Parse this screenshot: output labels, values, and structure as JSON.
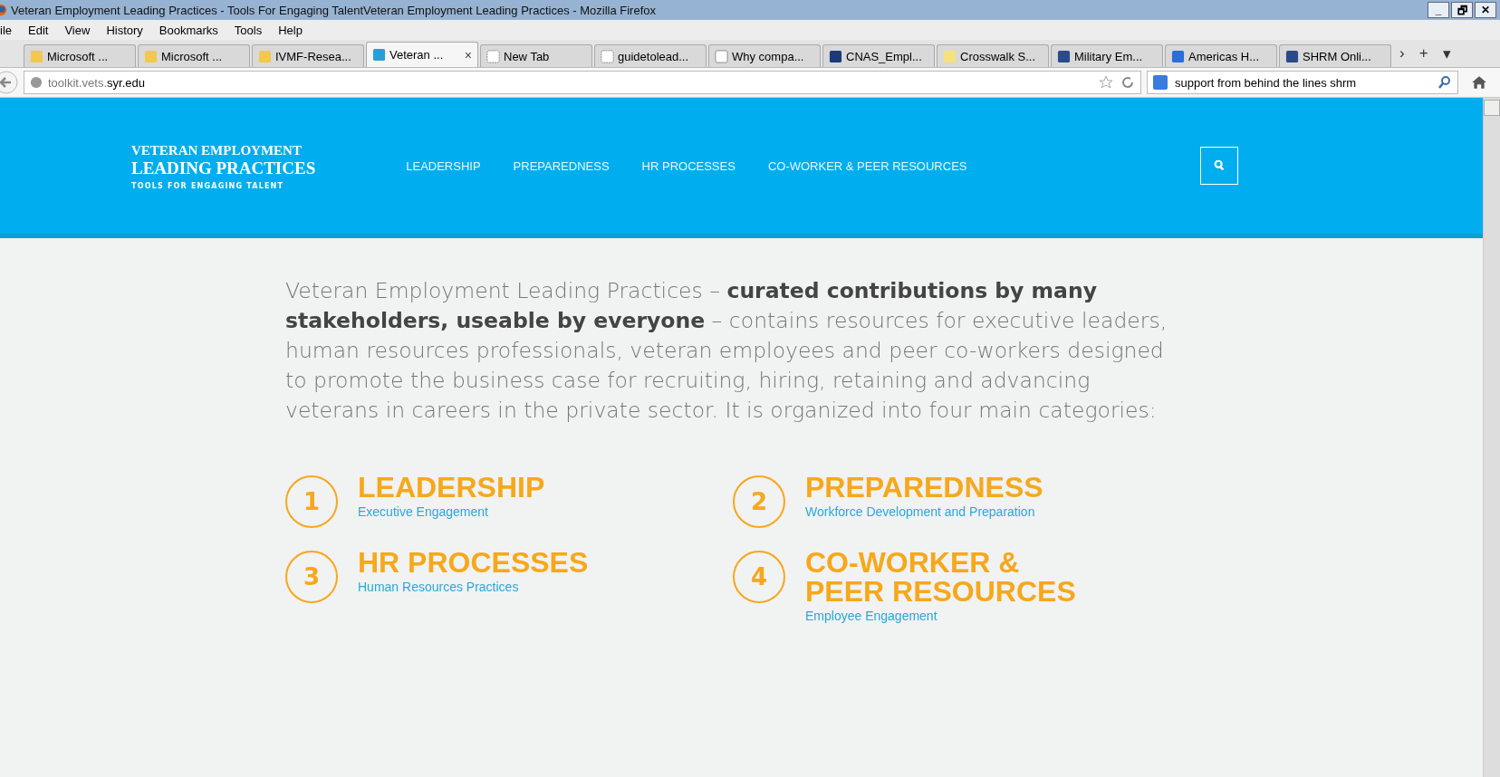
{
  "window": {
    "title": "Veteran Employment Leading Practices - Tools For Engaging TalentVeteran Employment Leading Practices - Mozilla Firefox",
    "controls": [
      "_",
      "🗗",
      "✕"
    ]
  },
  "menu": [
    "ile",
    "Edit",
    "View",
    "History",
    "Bookmarks",
    "Tools",
    "Help"
  ],
  "tabs": [
    {
      "label": "Microsoft ...",
      "kind": "ie",
      "selected": false
    },
    {
      "label": "Microsoft ...",
      "kind": "ie",
      "selected": false
    },
    {
      "label": "IVMF-Resea...",
      "kind": "ie",
      "selected": false
    },
    {
      "label": "Veteran ...",
      "kind": "vet",
      "selected": true,
      "close": "×"
    },
    {
      "label": "New Tab",
      "kind": "blank",
      "selected": false
    },
    {
      "label": "guidetolead...",
      "kind": "blank",
      "selected": false
    },
    {
      "label": "Why compa...",
      "kind": "wp",
      "selected": false
    },
    {
      "label": "CNAS_Empl...",
      "kind": "cnas",
      "selected": false
    },
    {
      "label": "Crosswalk S...",
      "kind": "onet",
      "selected": false
    },
    {
      "label": "Military Em...",
      "kind": "hr",
      "selected": false
    },
    {
      "label": "Americas H...",
      "kind": "globe",
      "selected": false
    },
    {
      "label": "SHRM Onli...",
      "kind": "hr",
      "selected": false
    }
  ],
  "tab_bar_buttons": [
    "›",
    "+",
    "▾"
  ],
  "address": {
    "host_prefix": "toolkit.vets.",
    "host_domain": "syr.edu"
  },
  "search": {
    "value": "support from behind the lines shrm"
  },
  "site": {
    "logo": [
      "VETERAN EMPLOYMENT",
      "LEADING PRACTICES",
      "TOOLS FOR ENGAGING TALENT"
    ],
    "nav": [
      "LEADERSHIP",
      "PREPAREDNESS",
      "HR PROCESSES",
      "CO-WORKER & PEER RESOURCES"
    ]
  },
  "intro": "Veteran Employment Leading Practices – **curated contributions by many stakeholders, useable by everyone** – contains resources for executive leaders, human resources professionals, veteran employees and peer co-workers designed to promote the business case for recruiting, hiring, retaining and advancing veterans in careers in the private sector. It is organized into four main categories:",
  "categories": [
    {
      "number": "1",
      "title": "LEADERSHIP",
      "subtitle": "Executive Engagement"
    },
    {
      "number": "2",
      "title": "PREPAREDNESS",
      "subtitle": "Workforce Development and Preparation"
    },
    {
      "number": "3",
      "title": "HR PROCESSES",
      "subtitle": "Human Resources Practices"
    },
    {
      "number": "4",
      "title": "CO-WORKER & PEER RESOURCES",
      "subtitle": "Employee Engagement"
    }
  ]
}
